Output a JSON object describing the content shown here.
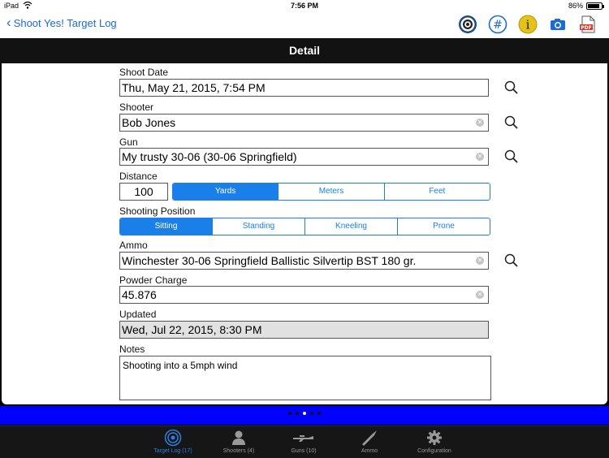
{
  "status": {
    "carrier": "iPad",
    "time": "7:56 PM",
    "battery": "86%",
    "battery_level": 0.86
  },
  "nav": {
    "back_label": "Shoot Yes! Target Log",
    "icons": [
      "target-icon",
      "hash-icon",
      "info-icon",
      "camera-icon",
      "pdf-icon"
    ],
    "pdf_text": "PDF"
  },
  "header": {
    "title": "Detail"
  },
  "form": {
    "shoot_date": {
      "label": "Shoot Date",
      "value": "Thu, May 21, 2015, 7:54 PM"
    },
    "shooter": {
      "label": "Shooter",
      "value": "Bob Jones"
    },
    "gun": {
      "label": "Gun",
      "value": "My trusty 30-06 (30-06 Springfield)"
    },
    "distance": {
      "label": "Distance",
      "value": "100",
      "units": [
        "Yards",
        "Meters",
        "Feet"
      ],
      "selected": "Yards"
    },
    "position": {
      "label": "Shooting Position",
      "options": [
        "Sitting",
        "Standing",
        "Kneeling",
        "Prone"
      ],
      "selected": "Sitting"
    },
    "ammo": {
      "label": "Ammo",
      "value": "Winchester 30-06 Springfield Ballistic Silvertip BST 180 gr."
    },
    "powder": {
      "label": "Powder Charge",
      "value": "45.876"
    },
    "updated": {
      "label": "Updated",
      "value": "Wed, Jul 22, 2015, 8:30 PM"
    },
    "notes": {
      "label": "Notes",
      "value": "Shooting into a 5mph wind"
    }
  },
  "pager": {
    "count": 5,
    "active_index": 2
  },
  "tabs": [
    {
      "label": "Target Log (17)",
      "icon": "target-icon",
      "active": true
    },
    {
      "label": "Shooters (4)",
      "icon": "person-icon",
      "active": false
    },
    {
      "label": "Guns (10)",
      "icon": "rifle-icon",
      "active": false
    },
    {
      "label": "Ammo",
      "icon": "bullet-icon",
      "active": false
    },
    {
      "label": "Configuration",
      "icon": "gear-icon",
      "active": false
    }
  ],
  "colors": {
    "accent": "#1a7fe8",
    "bluebar": "#0000ff",
    "header": "#121212",
    "tabbar": "#161616"
  }
}
